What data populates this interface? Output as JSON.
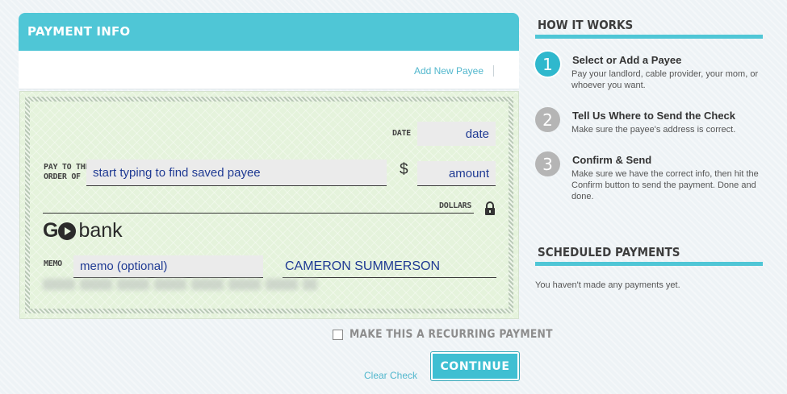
{
  "payment_info": {
    "title": "PAYMENT INFO",
    "add_new_payee": "Add New Payee"
  },
  "check": {
    "date_label": "DATE",
    "date_placeholder": "date",
    "pay_to_label_1": "PAY TO THE",
    "pay_to_label_2": "ORDER OF",
    "payee_placeholder": "start typing to find saved payee",
    "dollar_sign": "$",
    "amount_placeholder": "amount",
    "dollars_label": "DOLLARS",
    "logo_go": "G",
    "logo_bank": "bank",
    "memo_label": "MEMO",
    "memo_placeholder": "memo (optional)",
    "signature_name": "CAMERON SUMMERSON"
  },
  "recurring_label": "MAKE THIS A RECURRING PAYMENT",
  "clear_check": "Clear Check",
  "continue_label": "CONTINUE",
  "how_it_works": {
    "title": "HOW IT WORKS",
    "steps": [
      {
        "number": "1",
        "title": "Select or Add a Payee",
        "description": "Pay your landlord, cable provider, your mom, or whoever you want."
      },
      {
        "number": "2",
        "title": "Tell Us Where to Send the Check",
        "description": "Make sure the payee's address is correct."
      },
      {
        "number": "3",
        "title": "Confirm & Send",
        "description": "Make sure we have the correct info, then hit the Confirm button to send the payment. Done and done."
      }
    ]
  },
  "scheduled_payments": {
    "title": "SCHEDULED PAYMENTS",
    "empty_message": "You haven't made any payments yet."
  },
  "colors": {
    "accent": "#4fc6d6",
    "link": "#52b7cd",
    "check_background": "#e5f3dc",
    "field_text": "#1f3a93"
  }
}
